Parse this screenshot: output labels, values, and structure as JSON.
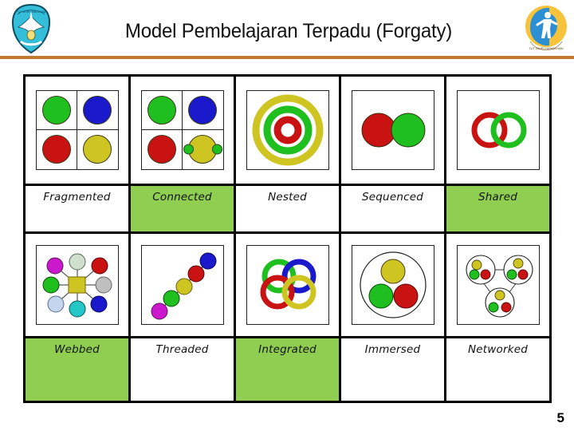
{
  "header": {
    "title": "Model Pembelajaran Terpadu (Forgaty)",
    "left_logo_name": "tut-wuri-handayani-logo",
    "right_logo_name": "organization-circle-logo",
    "rule_color": "#BE7B2E"
  },
  "colors": {
    "highlight_green": "#8FCE50",
    "green": "#1FBF1F",
    "blue": "#1A1ACC",
    "red": "#C91212",
    "yellow": "#CFC522",
    "magenta": "#CC18CC",
    "cyan": "#25C6C6",
    "gray": "#BFBFBF",
    "light_blue": "#C3D6EE",
    "pale_green": "#CFE0CF",
    "border": "#000000"
  },
  "table": {
    "rows": [
      {
        "cells": [
          {
            "label": "Fragmented",
            "highlighted": false,
            "diagram": "fragmented-diagram"
          },
          {
            "label": "Connected",
            "highlighted": true,
            "diagram": "connected-diagram"
          },
          {
            "label": "Nested",
            "highlighted": false,
            "diagram": "nested-diagram"
          },
          {
            "label": "Sequenced",
            "highlighted": false,
            "diagram": "sequenced-diagram"
          },
          {
            "label": "Shared",
            "highlighted": true,
            "diagram": "shared-diagram"
          }
        ]
      },
      {
        "cells": [
          {
            "label": "Webbed",
            "highlighted": true,
            "diagram": "webbed-diagram"
          },
          {
            "label": "Threaded",
            "highlighted": false,
            "diagram": "threaded-diagram"
          },
          {
            "label": "Integrated",
            "highlighted": true,
            "diagram": "integrated-diagram"
          },
          {
            "label": "Immersed",
            "highlighted": false,
            "diagram": "immersed-diagram"
          },
          {
            "label": "Networked",
            "highlighted": false,
            "diagram": "networked-diagram"
          }
        ]
      }
    ]
  },
  "footer": {
    "page_number": "5"
  }
}
